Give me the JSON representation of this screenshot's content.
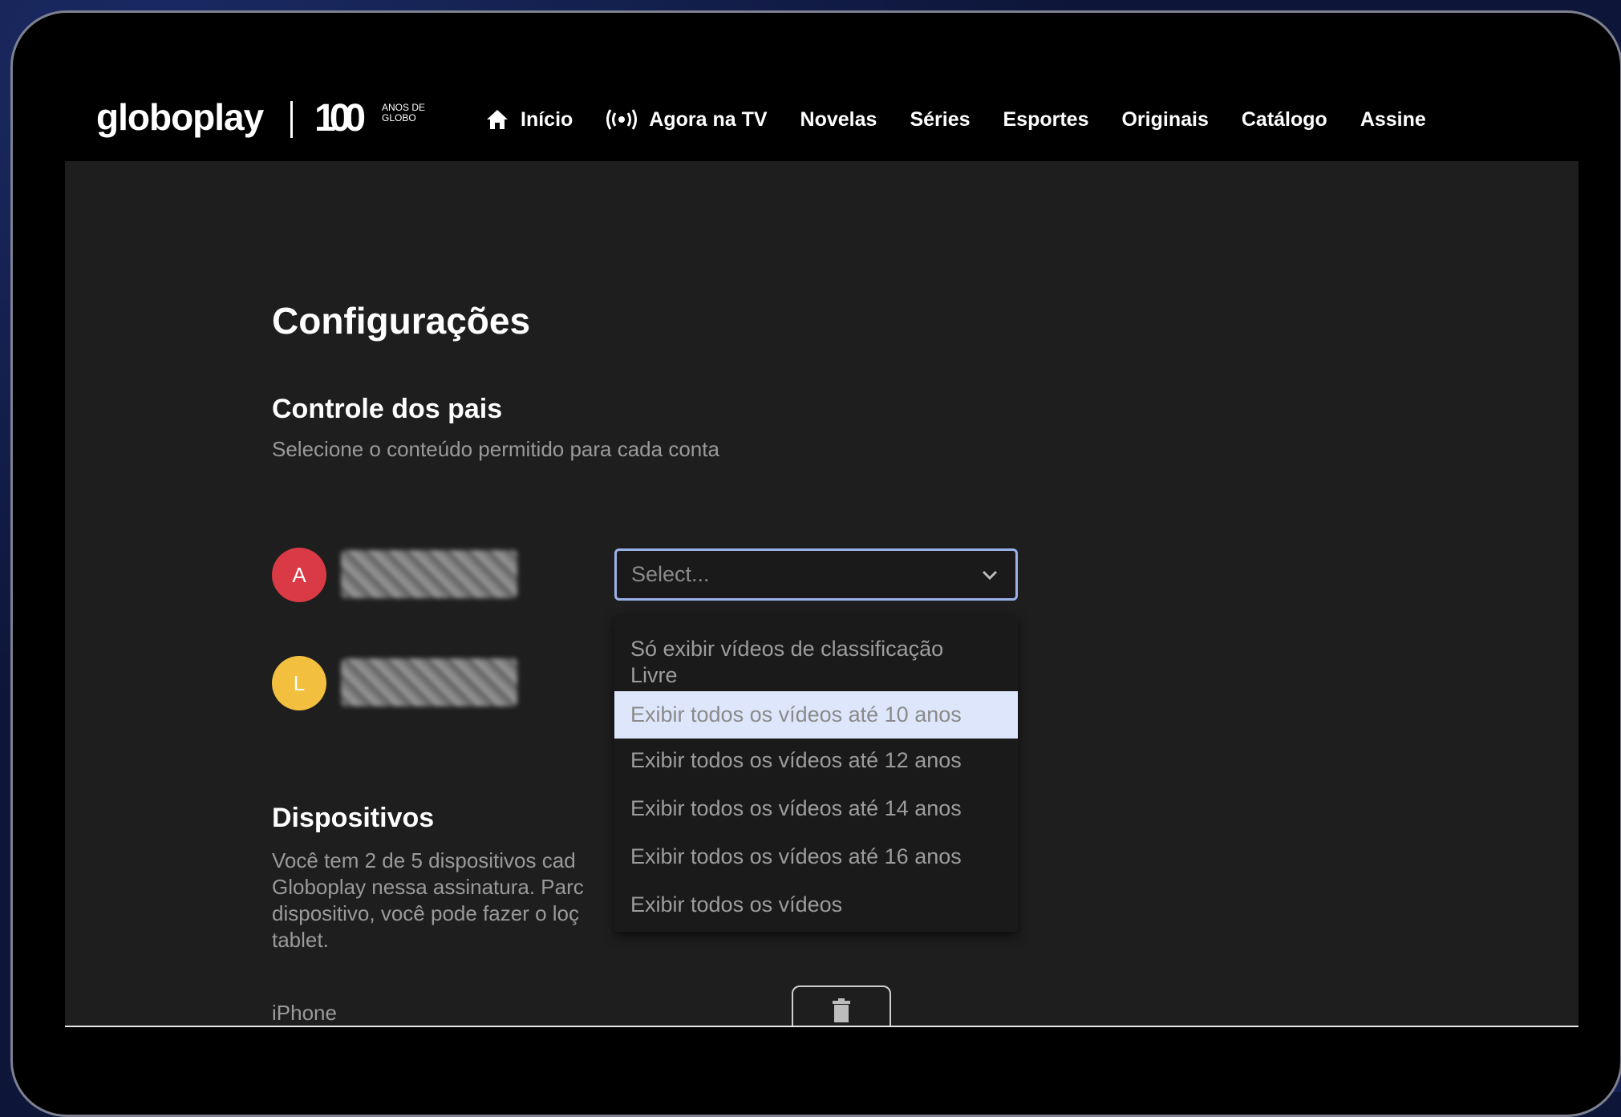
{
  "header": {
    "logo_text": "globoplay",
    "logo_100": "100",
    "logo_anos": "ANOS DE GLOBO",
    "nav": [
      {
        "label": "Início",
        "icon": "home-icon"
      },
      {
        "label": "Agora na TV",
        "icon": "broadcast-icon"
      },
      {
        "label": "Novelas"
      },
      {
        "label": "Séries"
      },
      {
        "label": "Esportes"
      },
      {
        "label": "Originais"
      },
      {
        "label": "Catálogo"
      },
      {
        "label": "Assine"
      }
    ]
  },
  "settings": {
    "title": "Configurações",
    "parental": {
      "title": "Controle dos pais",
      "subtitle": "Selecione o conteúdo permitido para cada conta",
      "profiles": [
        {
          "initial": "A",
          "color": "#d93a45"
        },
        {
          "initial": "L",
          "color": "#f2bf3f"
        }
      ],
      "select_placeholder": "Select...",
      "options": [
        "Só exibir vídeos de classificação",
        "Livre",
        "Exibir todos os vídeos até 10 anos",
        "Exibir todos os vídeos até 12 anos",
        "Exibir todos os vídeos até 14 anos",
        "Exibir todos os vídeos até 16 anos",
        "Exibir todos os vídeos"
      ]
    },
    "devices": {
      "title": "Dispositivos",
      "desc_lines": [
        "Você tem 2 de 5 dispositivos cad",
        "Globoplay nessa assinatura. Parc",
        "dispositivo, você pode fazer o loç",
        "tablet."
      ],
      "first_device": "iPhone"
    }
  },
  "colors": {
    "panel": "#1e1e1e",
    "accent_border": "#9ab1ea",
    "highlight": "#dde6fb"
  }
}
